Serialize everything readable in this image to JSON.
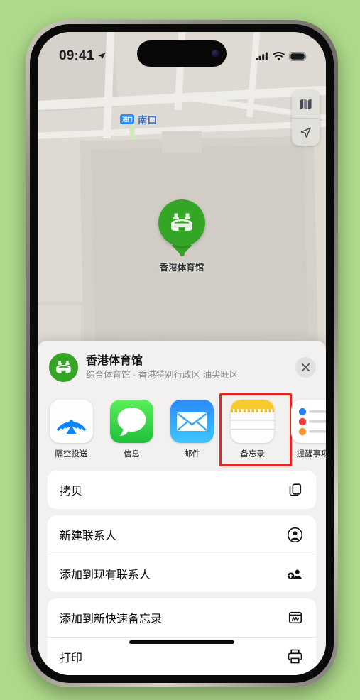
{
  "device": {
    "frame": "iphone-14-pro",
    "background_color": "#aed98a"
  },
  "status_bar": {
    "time": "09:41",
    "location_arrow_icon": "location-arrow-icon",
    "cellular_icon": "cellular-signal-icon",
    "wifi_icon": "wifi-icon",
    "battery_icon": "battery-full-icon"
  },
  "map": {
    "pin": {
      "label": "香港体育馆",
      "icon": "stadium-icon",
      "color": "#34a524"
    },
    "labels": [
      {
        "badge": "进口",
        "text": "南口",
        "badge_color": "#2a8cf0",
        "text_color": "#3d6fb5"
      }
    ],
    "controls": [
      {
        "name": "map-type-button",
        "icon": "map-layers-icon"
      },
      {
        "name": "locate-me-button",
        "icon": "location-arrow-icon"
      }
    ]
  },
  "share_sheet": {
    "place": {
      "icon": "stadium-icon",
      "icon_color": "#34a524",
      "title": "香港体育馆",
      "subtitle": "综合体育馆 · 香港特别行政区 油尖旺区"
    },
    "close_button": {
      "label": "✕",
      "icon": "close-icon"
    },
    "apps": [
      {
        "name": "airdrop",
        "label": "隔空投送",
        "icon": "airdrop-icon",
        "color": "#0a84ff",
        "highlighted": false
      },
      {
        "name": "messages",
        "label": "信息",
        "icon": "messages-icon",
        "color": "#43cd47",
        "highlighted": false
      },
      {
        "name": "mail",
        "label": "邮件",
        "icon": "mail-icon",
        "color": "#1d9bf7",
        "highlighted": false
      },
      {
        "name": "notes",
        "label": "备忘录",
        "icon": "notes-icon",
        "color": "#f7c325",
        "highlighted": true
      },
      {
        "name": "reminders",
        "label": "提醒事项",
        "icon": "reminders-icon",
        "color": "#0a84ff",
        "highlighted": false
      }
    ],
    "highlight_color": "#e8261f",
    "action_groups": [
      {
        "rows": [
          {
            "name": "copy",
            "label": "拷贝",
            "icon": "copy-icon"
          }
        ]
      },
      {
        "rows": [
          {
            "name": "create-new-contact",
            "label": "新建联系人",
            "icon": "person-circle-icon"
          },
          {
            "name": "add-to-existing-contact",
            "label": "添加到现有联系人",
            "icon": "person-add-icon"
          }
        ]
      },
      {
        "rows": [
          {
            "name": "add-to-new-quick-note",
            "label": "添加到新快速备忘录",
            "icon": "quick-note-icon"
          },
          {
            "name": "print",
            "label": "打印",
            "icon": "printer-icon"
          }
        ]
      }
    ]
  }
}
